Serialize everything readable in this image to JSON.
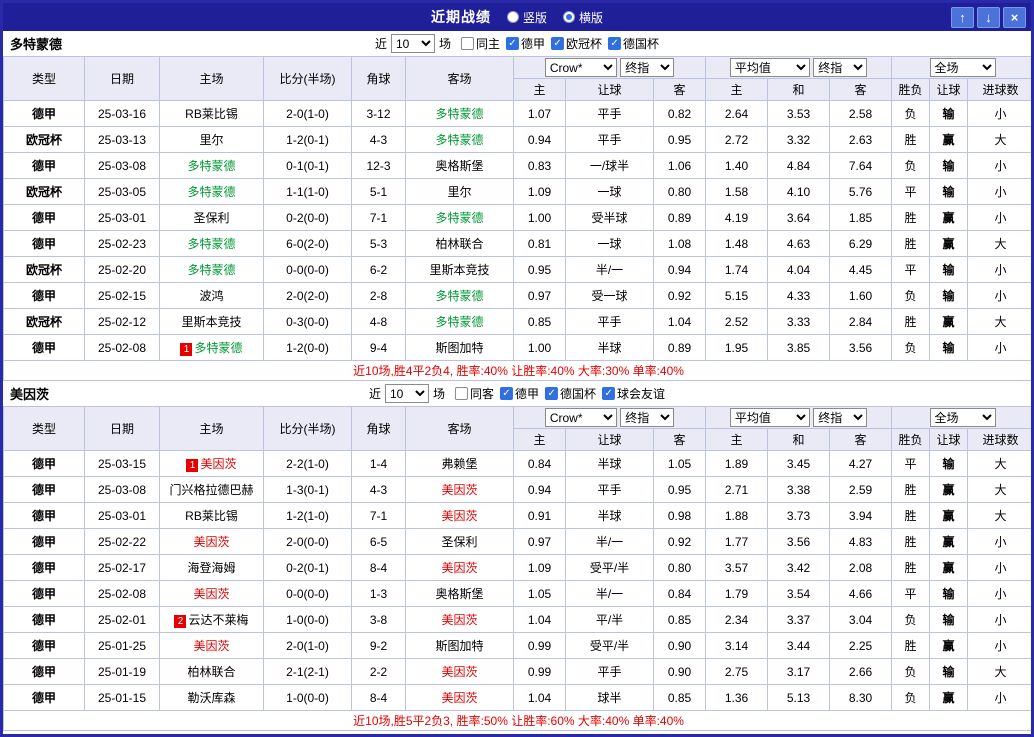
{
  "titlebar": {
    "title": "近期战绩",
    "layout_options": [
      {
        "label": "竖版",
        "selected": false
      },
      {
        "label": "横版",
        "selected": true
      }
    ],
    "buttons": {
      "up": "↑",
      "down": "↓",
      "close": "×"
    }
  },
  "columns": {
    "type": "类型",
    "date": "日期",
    "home": "主场",
    "score": "比分(半场)",
    "corner": "角球",
    "away": "客场",
    "odds_select": "Crow*",
    "odds_final": "终指",
    "avg_select": "平均值",
    "avg_final": "终指",
    "scope_select": "全场",
    "odds_home": "主",
    "odds_handicap": "让球",
    "odds_away": "客",
    "avg_home": "主",
    "avg_draw": "和",
    "avg_away": "客",
    "result": "胜负",
    "handicap_result": "让球",
    "goals": "进球数"
  },
  "colors": {
    "titlebar_bg": "#1f1f9a",
    "dortmund_green": "#009933",
    "mainz_red": "#e00000",
    "bundesliga_purple": "#9900aa",
    "cup_orange": "#ff6600",
    "win_red": "#e80000",
    "lose_blue": "#0000e0",
    "handicap_win_bg": "#f23b3b",
    "handicap_lose_bg": "#3f5de8"
  },
  "sections": [
    {
      "team": "多特蒙德",
      "team_color": "#009933",
      "filter": {
        "prefix": "近",
        "count": "10",
        "suffix": "场",
        "checkboxes": [
          {
            "label": "同主",
            "checked": false
          },
          {
            "label": "德甲",
            "checked": true
          },
          {
            "label": "欧冠杯",
            "checked": true
          },
          {
            "label": "德国杯",
            "checked": true
          }
        ]
      },
      "rows": [
        {
          "league": "德甲",
          "date": "25-03-16",
          "home": "RB莱比锡",
          "score": "2-0(1-0)",
          "corner": "3-12",
          "away": "多特蒙德",
          "away_hl": true,
          "odds": [
            "1.07",
            "平手",
            "0.82"
          ],
          "avg": [
            "2.64",
            "3.53",
            "2.58"
          ],
          "result": "负",
          "handicap_result": "输",
          "goals": "小"
        },
        {
          "league": "欧冠杯",
          "date": "25-03-13",
          "home": "里尔",
          "score": "1-2(0-1)",
          "corner": "4-3",
          "away": "多特蒙德",
          "away_hl": true,
          "odds": [
            "0.94",
            "平手",
            "0.95"
          ],
          "avg": [
            "2.72",
            "3.32",
            "2.63"
          ],
          "result": "胜",
          "handicap_result": "赢",
          "goals": "大"
        },
        {
          "league": "德甲",
          "date": "25-03-08",
          "home": "多特蒙德",
          "home_hl": true,
          "score": "0-1(0-1)",
          "corner": "12-3",
          "away": "奥格斯堡",
          "odds": [
            "0.83",
            "一/球半",
            "1.06"
          ],
          "avg": [
            "1.40",
            "4.84",
            "7.64"
          ],
          "result": "负",
          "handicap_result": "输",
          "goals": "小"
        },
        {
          "league": "欧冠杯",
          "date": "25-03-05",
          "home": "多特蒙德",
          "home_hl": true,
          "score": "1-1(1-0)",
          "corner": "5-1",
          "away": "里尔",
          "odds": [
            "1.09",
            "一球",
            "0.80"
          ],
          "avg": [
            "1.58",
            "4.10",
            "5.76"
          ],
          "result": "平",
          "handicap_result": "输",
          "goals": "小"
        },
        {
          "league": "德甲",
          "date": "25-03-01",
          "home": "圣保利",
          "score": "0-2(0-0)",
          "corner": "7-1",
          "away": "多特蒙德",
          "away_hl": true,
          "odds": [
            "1.00",
            "受半球",
            "0.89"
          ],
          "avg": [
            "4.19",
            "3.64",
            "1.85"
          ],
          "result": "胜",
          "handicap_result": "赢",
          "goals": "小"
        },
        {
          "league": "德甲",
          "date": "25-02-23",
          "home": "多特蒙德",
          "home_hl": true,
          "score": "6-0(2-0)",
          "corner": "5-3",
          "away": "柏林联合",
          "odds": [
            "0.81",
            "一球",
            "1.08"
          ],
          "avg": [
            "1.48",
            "4.63",
            "6.29"
          ],
          "result": "胜",
          "handicap_result": "赢",
          "goals": "大"
        },
        {
          "league": "欧冠杯",
          "date": "25-02-20",
          "home": "多特蒙德",
          "home_hl": true,
          "score": "0-0(0-0)",
          "corner": "6-2",
          "away": "里斯本竞技",
          "odds": [
            "0.95",
            "半/一",
            "0.94"
          ],
          "avg": [
            "1.74",
            "4.04",
            "4.45"
          ],
          "result": "平",
          "handicap_result": "输",
          "goals": "小"
        },
        {
          "league": "德甲",
          "date": "25-02-15",
          "home": "波鸿",
          "score": "2-0(2-0)",
          "corner": "2-8",
          "away": "多特蒙德",
          "away_hl": true,
          "odds": [
            "0.97",
            "受一球",
            "0.92"
          ],
          "avg": [
            "5.15",
            "4.33",
            "1.60"
          ],
          "result": "负",
          "handicap_result": "输",
          "goals": "小"
        },
        {
          "league": "欧冠杯",
          "date": "25-02-12",
          "home": "里斯本竞技",
          "score": "0-3(0-0)",
          "corner": "4-8",
          "away": "多特蒙德",
          "away_hl": true,
          "odds": [
            "0.85",
            "平手",
            "1.04"
          ],
          "avg": [
            "2.52",
            "3.33",
            "2.84"
          ],
          "result": "胜",
          "handicap_result": "赢",
          "goals": "大"
        },
        {
          "league": "德甲",
          "date": "25-02-08",
          "home": "多特蒙德",
          "home_hl": true,
          "home_badge": "1",
          "score": "1-2(0-0)",
          "corner": "9-4",
          "away": "斯图加特",
          "odds": [
            "1.00",
            "半球",
            "0.89"
          ],
          "avg": [
            "1.95",
            "3.85",
            "3.56"
          ],
          "result": "负",
          "handicap_result": "输",
          "goals": "小"
        }
      ],
      "summary": "近10场,胜4平2负4, 胜率:40%  让胜率:40%  大率:30%  单率:40%"
    },
    {
      "team": "美因茨",
      "team_color": "#e00000",
      "filter": {
        "prefix": "近",
        "count": "10",
        "suffix": "场",
        "checkboxes": [
          {
            "label": "同客",
            "checked": false
          },
          {
            "label": "德甲",
            "checked": true
          },
          {
            "label": "德国杯",
            "checked": true
          },
          {
            "label": "球会友谊",
            "checked": true
          }
        ]
      },
      "rows": [
        {
          "league": "德甲",
          "date": "25-03-15",
          "home": "美因茨",
          "home_hl": true,
          "home_badge": "1",
          "score": "2-2(1-0)",
          "corner": "1-4",
          "away": "弗赖堡",
          "odds": [
            "0.84",
            "半球",
            "1.05"
          ],
          "avg": [
            "1.89",
            "3.45",
            "4.27"
          ],
          "result": "平",
          "handicap_result": "输",
          "goals": "大"
        },
        {
          "league": "德甲",
          "date": "25-03-08",
          "home": "门兴格拉德巴赫",
          "score": "1-3(0-1)",
          "corner": "4-3",
          "away": "美因茨",
          "away_hl": true,
          "odds": [
            "0.94",
            "平手",
            "0.95"
          ],
          "avg": [
            "2.71",
            "3.38",
            "2.59"
          ],
          "result": "胜",
          "handicap_result": "赢",
          "goals": "大"
        },
        {
          "league": "德甲",
          "date": "25-03-01",
          "home": "RB莱比锡",
          "score": "1-2(1-0)",
          "corner": "7-1",
          "away": "美因茨",
          "away_hl": true,
          "odds": [
            "0.91",
            "半球",
            "0.98"
          ],
          "avg": [
            "1.88",
            "3.73",
            "3.94"
          ],
          "result": "胜",
          "handicap_result": "赢",
          "goals": "大"
        },
        {
          "league": "德甲",
          "date": "25-02-22",
          "home": "美因茨",
          "home_hl": true,
          "score": "2-0(0-0)",
          "corner": "6-5",
          "away": "圣保利",
          "odds": [
            "0.97",
            "半/一",
            "0.92"
          ],
          "avg": [
            "1.77",
            "3.56",
            "4.83"
          ],
          "result": "胜",
          "handicap_result": "赢",
          "goals": "小"
        },
        {
          "league": "德甲",
          "date": "25-02-17",
          "home": "海登海姆",
          "score": "0-2(0-1)",
          "corner": "8-4",
          "away": "美因茨",
          "away_hl": true,
          "odds": [
            "1.09",
            "受平/半",
            "0.80"
          ],
          "avg": [
            "3.57",
            "3.42",
            "2.08"
          ],
          "result": "胜",
          "handicap_result": "赢",
          "goals": "小"
        },
        {
          "league": "德甲",
          "date": "25-02-08",
          "home": "美因茨",
          "home_hl": true,
          "score": "0-0(0-0)",
          "corner": "1-3",
          "away": "奥格斯堡",
          "odds": [
            "1.05",
            "半/一",
            "0.84"
          ],
          "avg": [
            "1.79",
            "3.54",
            "4.66"
          ],
          "result": "平",
          "handicap_result": "输",
          "goals": "小"
        },
        {
          "league": "德甲",
          "date": "25-02-01",
          "home": "云达不莱梅",
          "home_badge": "2",
          "score": "1-0(0-0)",
          "corner": "3-8",
          "away": "美因茨",
          "away_hl": true,
          "odds": [
            "1.04",
            "平/半",
            "0.85"
          ],
          "avg": [
            "2.34",
            "3.37",
            "3.04"
          ],
          "result": "负",
          "handicap_result": "输",
          "goals": "小"
        },
        {
          "league": "德甲",
          "date": "25-01-25",
          "home": "美因茨",
          "home_hl": true,
          "score": "2-0(1-0)",
          "corner": "9-2",
          "away": "斯图加特",
          "odds": [
            "0.99",
            "受平/半",
            "0.90"
          ],
          "avg": [
            "3.14",
            "3.44",
            "2.25"
          ],
          "result": "胜",
          "handicap_result": "赢",
          "goals": "小"
        },
        {
          "league": "德甲",
          "date": "25-01-19",
          "home": "柏林联合",
          "score": "2-1(2-1)",
          "corner": "2-2",
          "away": "美因茨",
          "away_hl": true,
          "odds": [
            "0.99",
            "平手",
            "0.90"
          ],
          "avg": [
            "2.75",
            "3.17",
            "2.66"
          ],
          "result": "负",
          "handicap_result": "输",
          "goals": "大"
        },
        {
          "league": "德甲",
          "date": "25-01-15",
          "home": "勒沃库森",
          "score": "1-0(0-0)",
          "corner": "8-4",
          "away": "美因茨",
          "away_hl": true,
          "odds": [
            "1.04",
            "球半",
            "0.85"
          ],
          "avg": [
            "1.36",
            "5.13",
            "8.30"
          ],
          "result": "负",
          "handicap_result": "赢",
          "goals": "小"
        }
      ],
      "summary": "近10场,胜5平2负3, 胜率:50%  让胜率:60%  大率:40%  单率:40%"
    }
  ]
}
